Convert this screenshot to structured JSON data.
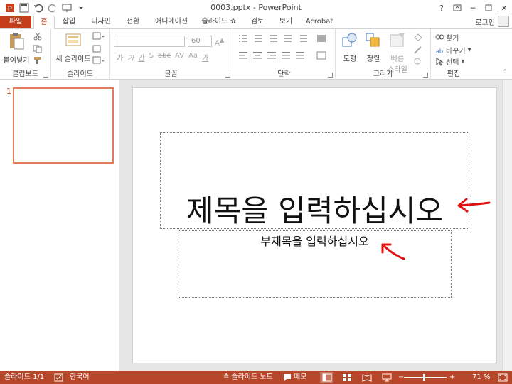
{
  "titlebar": {
    "title": "0003.pptx - PowerPoint",
    "qat_icons": [
      "save-icon",
      "undo-icon",
      "redo-icon",
      "presentation-icon",
      "customize-icon"
    ],
    "window_controls": [
      "?",
      "▢",
      "─",
      "▢",
      "✕"
    ]
  },
  "tabs": {
    "file": "파일",
    "items": [
      "홈",
      "삽입",
      "디자인",
      "전환",
      "애니메이션",
      "슬라이드 쇼",
      "검토",
      "보기",
      "Acrobat"
    ],
    "active_index": 0,
    "user": "로그인"
  },
  "ribbon": {
    "clipboard": {
      "label": "클립보드",
      "paste": "붙여넣기"
    },
    "slides": {
      "label": "슬라이드",
      "new_slide": "새 슬라이드"
    },
    "font": {
      "label": "글꼴",
      "font_name": "",
      "font_size": "60",
      "buttons": [
        "가",
        "가",
        "간",
        "S",
        "abc",
        "AV",
        "Aa",
        "가"
      ]
    },
    "paragraph": {
      "label": "단락"
    },
    "drawing": {
      "label": "그리기",
      "shapes": "도형",
      "arrange": "정렬",
      "quick_styles_line1": "빠른",
      "quick_styles_line2": "스타일"
    },
    "editing": {
      "label": "편집",
      "find": "찾기",
      "replace": "바꾸기",
      "select": "선택"
    }
  },
  "thumbnails": {
    "number": "1"
  },
  "slide": {
    "title_placeholder": "제목을 입력하십시오",
    "subtitle_placeholder": "부제목을 입력하십시오"
  },
  "annotations": {
    "arrow_color": "#e01010"
  },
  "statusbar": {
    "slide_info": "슬라이드 1/1",
    "language": "한국어",
    "notes": "슬라이드 노트",
    "comments": "메모",
    "zoom": "71 %"
  },
  "colors": {
    "accent": "#c43e1c",
    "statusbar": "#b7472a"
  }
}
